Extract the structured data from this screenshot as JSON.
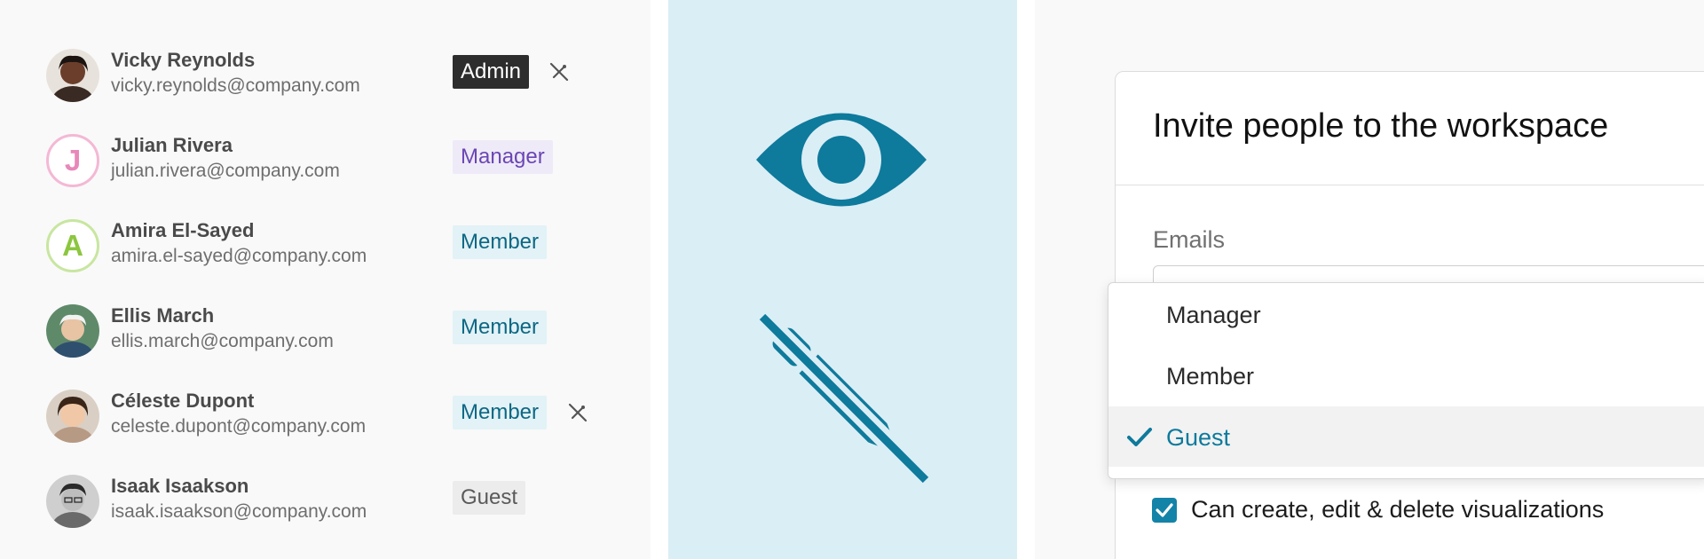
{
  "users": [
    {
      "name": "Vicky Reynolds",
      "email": "vicky.reynolds@company.com",
      "role": "Admin",
      "avatar": "photo",
      "can_edit": false
    },
    {
      "name": "Julian Rivera",
      "email": "julian.rivera@company.com",
      "role": "Manager",
      "avatar_initial": "J",
      "can_edit": true
    },
    {
      "name": "Amira El-Sayed",
      "email": "amira.el-sayed@company.com",
      "role": "Member",
      "avatar_initial": "A",
      "can_edit": true
    },
    {
      "name": "Ellis March",
      "email": "ellis.march@company.com",
      "role": "Member",
      "avatar": "photo",
      "can_edit": true
    },
    {
      "name": "Céleste Dupont",
      "email": "celeste.dupont@company.com",
      "role": "Member",
      "avatar": "photo",
      "can_edit": false
    },
    {
      "name": "Isaak Isaakson",
      "email": "isaak.isaakson@company.com",
      "role": "Guest",
      "avatar": "photo",
      "can_edit": true
    }
  ],
  "icons": {
    "view": "eye-icon",
    "no_edit": "pencil-slash-icon"
  },
  "invite": {
    "title": "Invite people to the workspace",
    "emails_label": "Emails",
    "emails_value": "",
    "role_options": [
      "Manager",
      "Member",
      "Guest"
    ],
    "selected_role": "Guest",
    "permission_label": "Can create, edit & delete visualizations",
    "permission_checked": true
  },
  "colors": {
    "accent": "#1483a8",
    "icon_panel_bg": "#daeef5",
    "icon_blue": "#0e7a9c",
    "admin_badge": "#2d2d2d",
    "manager_badge_text": "#6a46b4",
    "member_badge_text": "#0d6784"
  }
}
